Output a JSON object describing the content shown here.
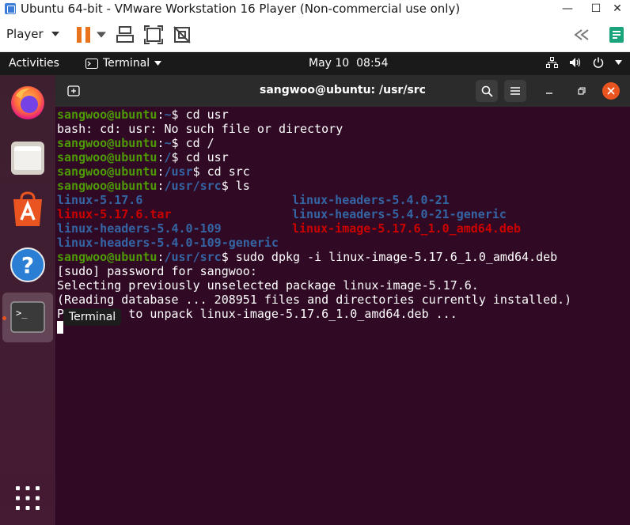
{
  "vm": {
    "window_title": "Ubuntu 64-bit - VMware Workstation 16 Player (Non-commercial use only)",
    "controls": {
      "minimize": "—",
      "maximize": "☐",
      "close": "✕"
    },
    "player_menu": "Player"
  },
  "topbar": {
    "activities": "Activities",
    "app_menu": "Terminal",
    "date": "May 10",
    "time": "08:54"
  },
  "dock": {
    "tooltip": "Terminal",
    "items": [
      "firefox",
      "files",
      "ubuntu-software",
      "help",
      "terminal",
      "show-applications"
    ]
  },
  "terminal": {
    "title": "sangwoo@ubuntu: /usr/src",
    "prompt_user": "sangwoo@ubuntu",
    "lines": [
      {
        "kind": "prompt",
        "path": "~",
        "cmd": "cd usr"
      },
      {
        "kind": "out",
        "text": "bash: cd: usr: No such file or directory"
      },
      {
        "kind": "prompt",
        "path": "~",
        "cmd": "cd /"
      },
      {
        "kind": "prompt",
        "path": "/",
        "cmd": "cd usr"
      },
      {
        "kind": "prompt",
        "path": "/usr",
        "cmd": "cd src"
      },
      {
        "kind": "prompt",
        "path": "/usr/src",
        "cmd": "ls"
      },
      {
        "kind": "ls",
        "cols": [
          {
            "text": "linux-5.17.6",
            "type": "dir"
          },
          {
            "text": "linux-headers-5.4.0-21",
            "type": "dir"
          }
        ]
      },
      {
        "kind": "ls",
        "cols": [
          {
            "text": "linux-5.17.6.tar",
            "type": "archive"
          },
          {
            "text": "linux-headers-5.4.0-21-generic",
            "type": "dir"
          }
        ]
      },
      {
        "kind": "ls",
        "cols": [
          {
            "text": "linux-headers-5.4.0-109",
            "type": "dir"
          },
          {
            "text": "linux-image-5.17.6_1.0_amd64.deb",
            "type": "archive"
          }
        ]
      },
      {
        "kind": "ls",
        "cols": [
          {
            "text": "linux-headers-5.4.0-109-generic",
            "type": "dir"
          }
        ]
      },
      {
        "kind": "prompt",
        "path": "/usr/src",
        "cmd": "sudo dpkg -i linux-image-5.17.6_1.0_amd64.deb"
      },
      {
        "kind": "out",
        "text": "[sudo] password for sangwoo:"
      },
      {
        "kind": "out",
        "text": "Selecting previously unselected package linux-image-5.17.6."
      },
      {
        "kind": "out",
        "text": "(Reading database ... 208951 files and directories currently installed.)"
      },
      {
        "kind": "out",
        "text": "Preparing to unpack linux-image-5.17.6_1.0_amd64.deb ..."
      }
    ]
  },
  "colors": {
    "terminal_bg": "#300a24",
    "user": "#4e9a06",
    "path": "#3465a4",
    "archive": "#cc0000",
    "accent": "#e95420"
  }
}
